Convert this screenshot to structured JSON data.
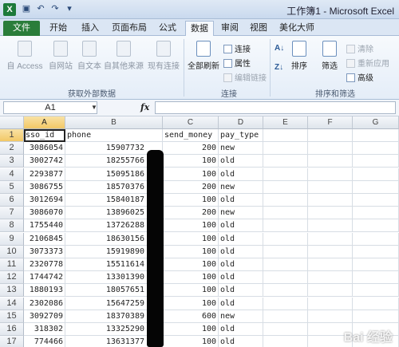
{
  "window": {
    "title": "工作簿1 - Microsoft Excel",
    "app_icon": "excel-icon"
  },
  "qat": {
    "icons": [
      "save-icon",
      "undo-icon",
      "redo-icon",
      "customize-icon"
    ]
  },
  "tabs": {
    "file": "文件",
    "home": "开始",
    "insert": "插入",
    "page_layout": "页面布局",
    "formulas": "公式",
    "data": "数据",
    "review": "审阅",
    "view": "视图",
    "beautify": "美化大师"
  },
  "ribbon": {
    "access": "自 Access",
    "web": "自网站",
    "text": "自文本",
    "other": "自其他来源",
    "existing": "现有连接",
    "group_external": "获取外部数据",
    "refresh_all": "全部刷新",
    "connections": "连接",
    "properties": "属性",
    "edit_links": "编辑链接",
    "group_connections": "连接",
    "sort_asc_icon": "sort-ascending-icon",
    "sort_desc_icon": "sort-descending-icon",
    "sort": "排序",
    "filter": "筛选",
    "clear": "清除",
    "reapply": "重新应用",
    "advanced": "高级",
    "group_sort_filter": "排序和筛选"
  },
  "formula_bar": {
    "name_box": "A1",
    "fx": "fx",
    "value": ""
  },
  "grid": {
    "columns": [
      "A",
      "B",
      "C",
      "D",
      "E",
      "F",
      "G"
    ],
    "rows": [
      {
        "n": "1",
        "a": "sso_id",
        "b": "phone",
        "c": "send_money",
        "d": "pay_type"
      },
      {
        "n": "2",
        "a": "3086054",
        "b": "15907732",
        "c": "200",
        "d": "new"
      },
      {
        "n": "3",
        "a": "3002742",
        "b": "18255766",
        "c": "100",
        "d": "old"
      },
      {
        "n": "4",
        "a": "2293877",
        "b": "15095186",
        "c": "100",
        "d": "old"
      },
      {
        "n": "5",
        "a": "3086755",
        "b": "18570376",
        "c": "200",
        "d": "new"
      },
      {
        "n": "6",
        "a": "3012694",
        "b": "15840187",
        "c": "100",
        "d": "old"
      },
      {
        "n": "7",
        "a": "3086070",
        "b": "13896025",
        "c": "200",
        "d": "new"
      },
      {
        "n": "8",
        "a": "1755440",
        "b": "13726288",
        "c": "100",
        "d": "old"
      },
      {
        "n": "9",
        "a": "2106845",
        "b": "18630156",
        "c": "100",
        "d": "old"
      },
      {
        "n": "10",
        "a": "3073373",
        "b": "15919890",
        "c": "100",
        "d": "old"
      },
      {
        "n": "11",
        "a": "2320778",
        "b": "15511614",
        "c": "100",
        "d": "old"
      },
      {
        "n": "12",
        "a": "1744742",
        "b": "13301390",
        "c": "100",
        "d": "old"
      },
      {
        "n": "13",
        "a": "1880193",
        "b": "18057651",
        "c": "100",
        "d": "old"
      },
      {
        "n": "14",
        "a": "2302086",
        "b": "15647259",
        "c": "100",
        "d": "old"
      },
      {
        "n": "15",
        "a": "3092709",
        "b": "18370389",
        "c": "600",
        "d": "new"
      },
      {
        "n": "16",
        "a": "318302",
        "b": "13325290",
        "c": "100",
        "d": "old"
      },
      {
        "n": "17",
        "a": "774466",
        "b": "13631377",
        "c": "100",
        "d": "old"
      }
    ]
  },
  "watermark": "Bai 经验"
}
